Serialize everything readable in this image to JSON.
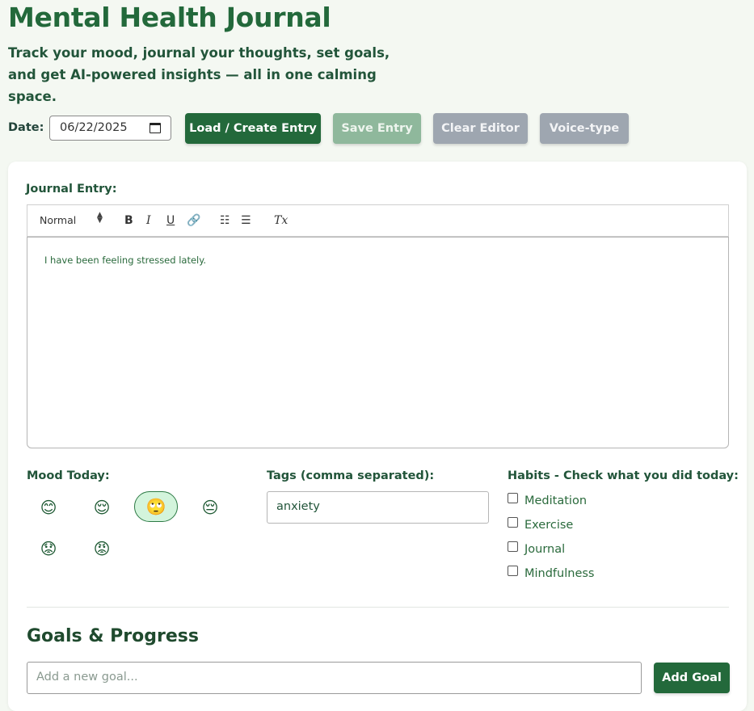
{
  "header": {
    "title": "Mental Health Journal",
    "subtitle": "Track your mood, journal your thoughts, set goals, and get AI-powered insights — all in one calming space."
  },
  "toolbar": {
    "date_label": "Date:",
    "date_value": "06/22/2025",
    "load_label": "Load / Create Entry",
    "save_label": "Save Entry",
    "clear_label": "Clear Editor",
    "voice_label": "Voice-type"
  },
  "editor": {
    "label": "Journal Entry:",
    "format_select": "Normal",
    "content": "I have been feeling stressed lately.",
    "tools": {
      "bold": "B",
      "italic": "I",
      "underline": "U",
      "link": "🔗",
      "ordered_list": "☷",
      "bullet_list": "☰",
      "clear_format": "Tx"
    }
  },
  "mood": {
    "label": "Mood Today:",
    "options": [
      {
        "emoji": "😊",
        "icon": "happy-face-icon"
      },
      {
        "emoji": "😌",
        "icon": "relieved-face-icon"
      },
      {
        "emoji": "🙄",
        "icon": "neutral-face-icon",
        "selected": true
      },
      {
        "emoji": "😔",
        "icon": "sad-face-icon"
      },
      {
        "emoji": "😟",
        "icon": "worried-face-icon"
      },
      {
        "emoji": "😡",
        "icon": "angry-face-icon"
      }
    ]
  },
  "tags": {
    "label": "Tags (comma separated):",
    "value": "anxiety"
  },
  "habits": {
    "label": "Habits - Check what you did today:",
    "items": [
      "Meditation",
      "Exercise",
      "Journal",
      "Mindfulness"
    ]
  },
  "goals": {
    "title": "Goals & Progress",
    "placeholder": "Add a new goal...",
    "add_label": "Add Goal"
  },
  "colors": {
    "primary": "#23693b",
    "background": "#f4f8f2",
    "selected_mood": "#d3f4dc",
    "disabled_green": "#8fb89c",
    "disabled_gray": "#9ea6b0"
  }
}
